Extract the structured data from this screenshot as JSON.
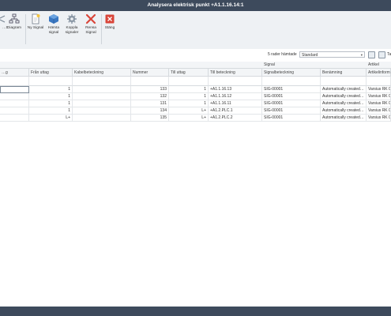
{
  "window": {
    "title": "Analysera elektrisk punkt +A1.1.16.14:1"
  },
  "ribbon": {
    "buttons": [
      {
        "label": "…t",
        "icon": "partial-icon"
      },
      {
        "label": "Diagram",
        "icon": "diagram-icon"
      },
      {
        "label": "Ny Signal",
        "icon": "new-signal-icon"
      },
      {
        "label": "Hämta signal",
        "icon": "fetch-signal-icon"
      },
      {
        "label": "Koppla signaler",
        "icon": "connect-signals-icon"
      },
      {
        "label": "Rensa Signal",
        "icon": "clear-signal-icon"
      },
      {
        "label": "Stäng",
        "icon": "close-icon"
      }
    ]
  },
  "toolbar": {
    "rows_label": "5 rader hämtade",
    "layout_value": "Standard",
    "right_label": "Ta"
  },
  "grid": {
    "groups": {
      "signal": "Signal",
      "artikel": "Artikel"
    },
    "columns": [
      "…g",
      "Från uttag",
      "Kabelbeteckning",
      "Nummer",
      "Till uttag",
      "Till beteckning",
      "Signalbeteckning",
      "Benämning",
      "Artikelinformati…"
    ],
    "rows": [
      [
        "",
        "1",
        "",
        "133",
        "1",
        "+A1.1.16.13",
        "SIG-00001",
        "Automatically created…",
        "Varsius RK 0,"
      ],
      [
        "",
        "1",
        "",
        "132",
        "1",
        "+A1.1.16.12",
        "SIG-00001",
        "Automatically created…",
        "Varsius RK 0,"
      ],
      [
        "",
        "1",
        "",
        "131",
        "1",
        "+A1.1.16.11",
        "SIG-00001",
        "Automatically created…",
        "Varsius RK 0,"
      ],
      [
        "",
        "1",
        "",
        "134",
        "L+",
        "+A1.2.PLC.1",
        "SIG-00001",
        "Automatically created…",
        "Varsius RK 0,"
      ],
      [
        "",
        "L+",
        "",
        "135",
        "L+",
        "+A1.2.PLC.2",
        "SIG-00001",
        "Automatically created…",
        "Varsius RK 0,"
      ]
    ]
  },
  "colors": {
    "titlebar": "#3d4a5c",
    "ribbon": "#eef1f4",
    "close_red": "#d9463a",
    "accent_blue": "#2f6db5"
  }
}
